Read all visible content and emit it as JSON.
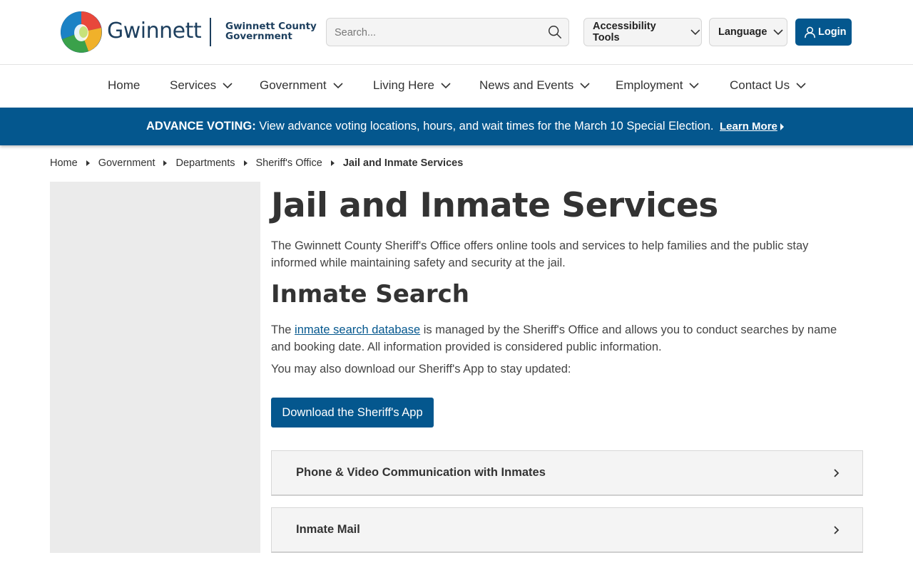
{
  "header": {
    "logo_word": "Gwinnett",
    "logo_sub_line1": "Gwinnett County",
    "logo_sub_line2": "Government",
    "search_placeholder": "Search...",
    "accessibility_label": "Accessibility Tools",
    "language_label": "Language",
    "login_label": "Login"
  },
  "nav": {
    "items": [
      {
        "label": "Home"
      },
      {
        "label": "Services"
      },
      {
        "label": "Government"
      },
      {
        "label": "Living Here"
      },
      {
        "label": "News and Events"
      },
      {
        "label": "Employment"
      },
      {
        "label": "Contact Us"
      }
    ]
  },
  "alert": {
    "strong": "ADVANCE VOTING:",
    "text": " View advance voting locations, hours, and wait times for the March 10 Special Election.",
    "link": "Learn More"
  },
  "breadcrumb": {
    "items": [
      "Home",
      "Government",
      "Departments",
      "Sheriff's Office"
    ],
    "current": "Jail and Inmate Services"
  },
  "main": {
    "title": "Jail and Inmate Services",
    "intro": "The Gwinnett County Sheriff's Office offers online tools and services to help families and the public stay informed while maintaining safety and security at the jail.",
    "section_title": "Inmate Search",
    "para2_before": "The ",
    "para2_link": "inmate search database",
    "para2_after": " is managed by the Sheriff's Office and allows you to conduct searches by name and booking date. All information provided is considered public information.",
    "para3": "You may also download our Sheriff's App to stay updated:",
    "app_button": "Download the Sheriff's App",
    "accordions": [
      {
        "label": "Phone & Video Communication with Inmates"
      },
      {
        "label": "Inmate Mail"
      }
    ]
  },
  "colors": {
    "primary": "#04578e",
    "sidebar_bg": "#ebebeb",
    "accordion_bg": "#f4f4f4"
  }
}
